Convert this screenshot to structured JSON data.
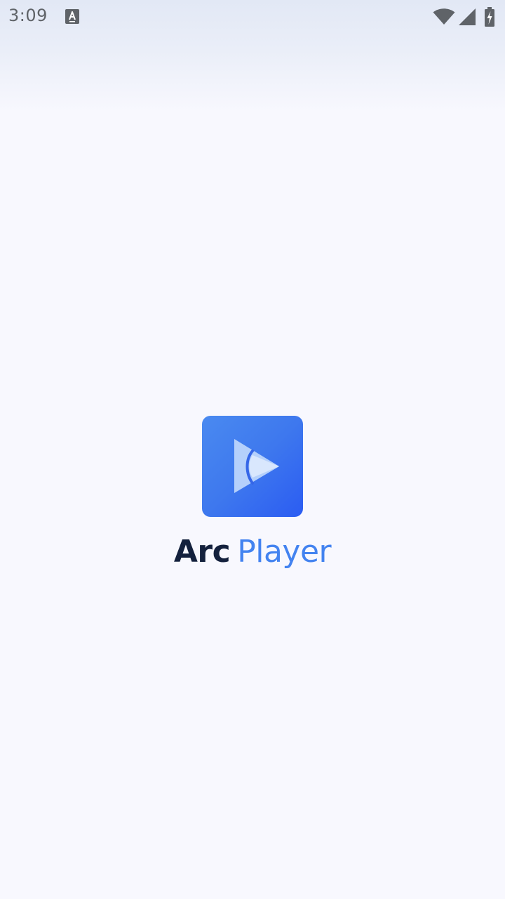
{
  "status_bar": {
    "time": "3:09",
    "notification_icon": "text-a-icon",
    "wifi_icon": "wifi-icon",
    "signal_icon": "cell-signal-icon",
    "battery_icon": "battery-charging-icon"
  },
  "splash": {
    "logo_icon": "play-arc-logo-icon",
    "app_name_part1": "Arc",
    "app_name_part2": "Player"
  },
  "colors": {
    "brand_blue": "#4383f0",
    "brand_dark": "#14213d",
    "background": "#f8f8fe"
  }
}
